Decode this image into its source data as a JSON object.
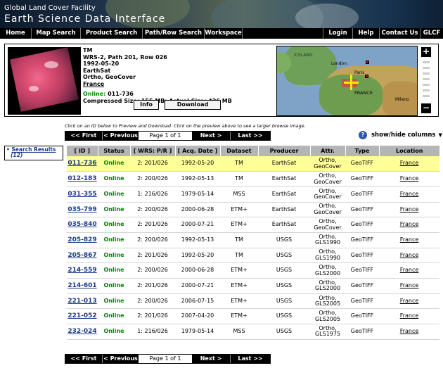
{
  "banner": {
    "line1": "Global Land Cover Facility",
    "line2": "Earth Science Data Interface"
  },
  "nav": [
    "Home",
    "Map Search",
    "Product Search",
    "Path/Row Search",
    "Workspace",
    "Login",
    "Help",
    "Contact Us",
    "GLCF"
  ],
  "preview": {
    "sensor": "TM",
    "wrs": "WRS-2, Path 201, Row 026",
    "date": "1992-05-20",
    "producer": "EarthSat",
    "attr": "Ortho, GeoCover",
    "location": "France",
    "status": "Online:",
    "id": "011-736",
    "size": "Compressed Size: 155 MB; Actual Size: 426 MB",
    "info_label": "Info",
    "download_label": "Download",
    "map_labels": [
      "ICELAND",
      "London",
      "Paris",
      "FRANCE",
      "Milano"
    ]
  },
  "hint": "Click on an ID below to Preview and Download. Click on the preview above to see a larger browse image.",
  "pager": {
    "first": "<< First",
    "prev": "< Previous",
    "page": "Page 1 of 1",
    "next": "Next >",
    "last": "Last >>"
  },
  "show_hide": "show/hide columns",
  "sidebar": {
    "label": "Search Results",
    "count": "(12)"
  },
  "columns": [
    "[ ID ]",
    "Status",
    "[ WRS: P/R ]",
    "[ Acq. Date ]",
    "Dataset",
    "Producer",
    "Attr.",
    "Type",
    "Location"
  ],
  "rows": [
    {
      "id": "011-736",
      "status": "Online",
      "wrs": "2: 201/026",
      "date": "1992-05-20",
      "dataset": "TM",
      "producer": "EarthSat",
      "attr1": "Ortho,",
      "attr2": "GeoCover",
      "type": "GeoTIFF",
      "location": "France"
    },
    {
      "id": "012-183",
      "status": "Online",
      "wrs": "2: 200/026",
      "date": "1992-05-13",
      "dataset": "TM",
      "producer": "EarthSat",
      "attr1": "Ortho,",
      "attr2": "GeoCover",
      "type": "GeoTIFF",
      "location": "France"
    },
    {
      "id": "031-355",
      "status": "Online",
      "wrs": "1: 216/026",
      "date": "1979-05-14",
      "dataset": "MSS",
      "producer": "EarthSat",
      "attr1": "Ortho,",
      "attr2": "GeoCover",
      "type": "GeoTIFF",
      "location": "France"
    },
    {
      "id": "035-799",
      "status": "Online",
      "wrs": "2: 200/026",
      "date": "2000-06-28",
      "dataset": "ETM+",
      "producer": "EarthSat",
      "attr1": "Ortho,",
      "attr2": "GeoCover",
      "type": "GeoTIFF",
      "location": "France"
    },
    {
      "id": "035-840",
      "status": "Online",
      "wrs": "2: 201/026",
      "date": "2000-07-21",
      "dataset": "ETM+",
      "producer": "EarthSat",
      "attr1": "Ortho,",
      "attr2": "GeoCover",
      "type": "GeoTIFF",
      "location": "France"
    },
    {
      "id": "205-829",
      "status": "Online",
      "wrs": "2: 200/026",
      "date": "1992-05-13",
      "dataset": "TM",
      "producer": "USGS",
      "attr1": "Ortho,",
      "attr2": "GLS1990",
      "type": "GeoTIFF",
      "location": "France"
    },
    {
      "id": "205-867",
      "status": "Online",
      "wrs": "2: 201/026",
      "date": "1992-05-20",
      "dataset": "TM",
      "producer": "USGS",
      "attr1": "Ortho,",
      "attr2": "GLS1990",
      "type": "GeoTIFF",
      "location": "France"
    },
    {
      "id": "214-559",
      "status": "Online",
      "wrs": "2: 200/026",
      "date": "2000-06-28",
      "dataset": "ETM+",
      "producer": "USGS",
      "attr1": "Ortho,",
      "attr2": "GLS2000",
      "type": "GeoTIFF",
      "location": "France"
    },
    {
      "id": "214-601",
      "status": "Online",
      "wrs": "2: 201/026",
      "date": "2000-07-21",
      "dataset": "ETM+",
      "producer": "USGS",
      "attr1": "Ortho,",
      "attr2": "GLS2000",
      "type": "GeoTIFF",
      "location": "France"
    },
    {
      "id": "221-013",
      "status": "Online",
      "wrs": "2: 200/026",
      "date": "2006-07-15",
      "dataset": "ETM+",
      "producer": "USGS",
      "attr1": "Ortho,",
      "attr2": "GLS2005",
      "type": "GeoTIFF",
      "location": "France"
    },
    {
      "id": "221-052",
      "status": "Online",
      "wrs": "2: 201/026",
      "date": "2007-04-20",
      "dataset": "ETM+",
      "producer": "USGS",
      "attr1": "Ortho,",
      "attr2": "GLS2005",
      "type": "GeoTIFF",
      "location": "France"
    },
    {
      "id": "232-024",
      "status": "Online",
      "wrs": "1: 216/026",
      "date": "1979-05-14",
      "dataset": "MSS",
      "producer": "USGS",
      "attr1": "Ortho,",
      "attr2": "GLS1975",
      "type": "GeoTIFF",
      "location": "France"
    }
  ],
  "colors": {
    "online": "#008800",
    "selected_row": "#ffff99",
    "header_bg": "#b5b5b5",
    "link": "#1a3a8a"
  }
}
